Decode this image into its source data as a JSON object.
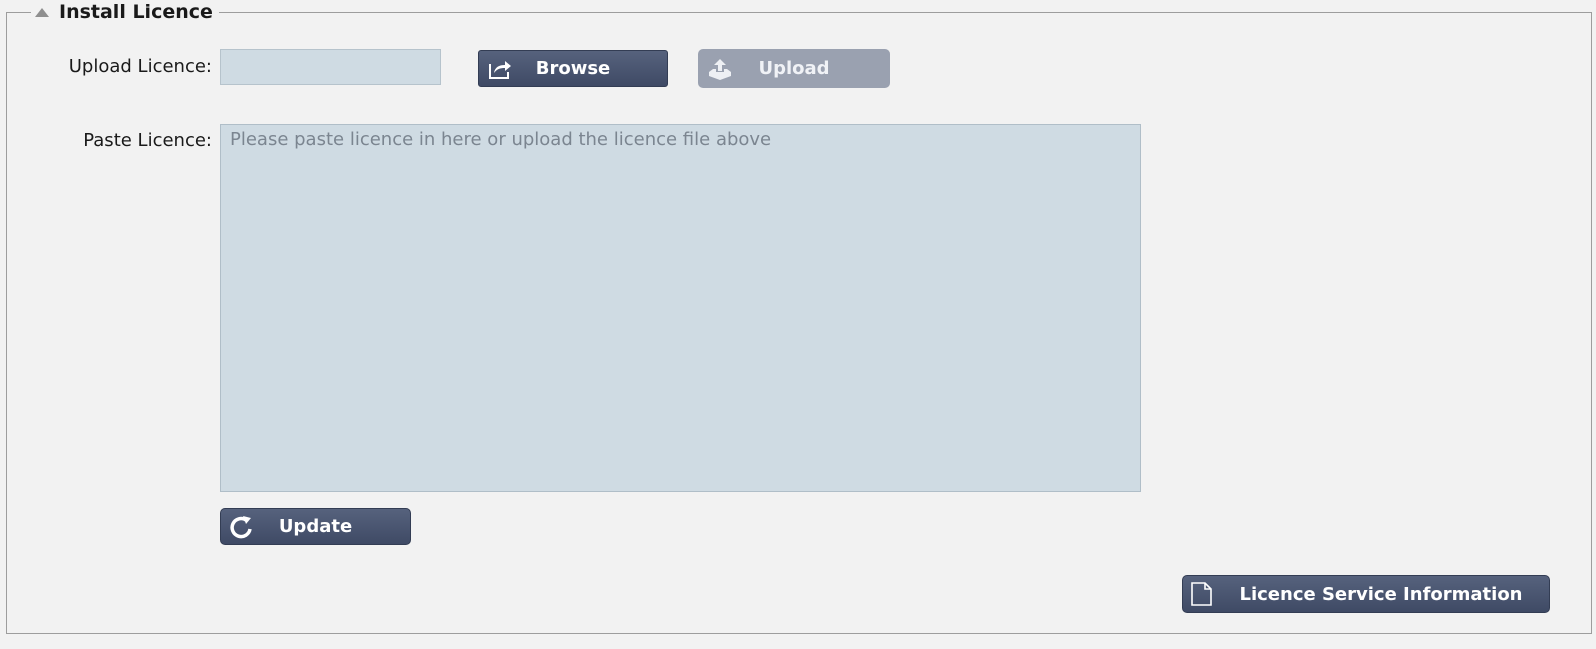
{
  "section": {
    "title": "Install Licence"
  },
  "form": {
    "upload_label": "Upload Licence:",
    "paste_label": "Paste Licence:",
    "paste_placeholder": "Please paste licence in here or upload the licence file above",
    "paste_value": ""
  },
  "buttons": {
    "browse": "Browse",
    "upload": "Upload",
    "update": "Update",
    "licence_info": "Licence Service Information"
  },
  "icons": {
    "collapse": "triangle-up-icon",
    "browse": "share-arrow-icon",
    "upload": "upload-tray-icon",
    "update": "refresh-icon",
    "licence_info": "document-icon"
  },
  "colors": {
    "button": "#4a5570",
    "button_disabled": "#9aa1b0",
    "input_bg": "#cfdbe3",
    "page_bg": "#f2f2f2"
  }
}
